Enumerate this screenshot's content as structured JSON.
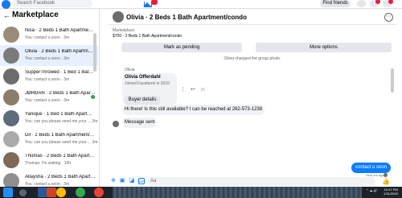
{
  "topbar": {
    "search_placeholder": "Search Facebook",
    "find_friends": "Find friends"
  },
  "sidebar": {
    "back_icon": "←",
    "title": "Marketplace",
    "items": [
      {
        "title": "Nisa · 2 Beds 1 Bath Apartment/...",
        "subtitle": "You: contact u soon · 3m",
        "active": false
      },
      {
        "title": "Olivia · 2 Beds 1 Bath Apartment/...",
        "subtitle": "You: contact u soon · 3m",
        "active": true
      },
      {
        "title": "SupperThrowed · 1 Bed 1 Bath Apart...",
        "subtitle": "You: contact u soon · 3m",
        "active": false
      },
      {
        "title": "JØRÐAN · 2 Beds 1 Bath Apartment/...",
        "subtitle": "You: contact u soon · 3m",
        "active": false
      },
      {
        "title": "Yanique · 1 Bed 1 Bath Apartment/...",
        "subtitle": "You: can you please send me your ... 3m",
        "active": false
      },
      {
        "title": "Dil · 2 Beds 1 Bath Apartment/condo",
        "subtitle": "You: can you please send me your ... 3m",
        "active": false
      },
      {
        "title": "Thomas · 2 Beds 1 Bath Apartment/...",
        "subtitle": "Thomas: I'm waiting · 10h",
        "active": false
      },
      {
        "title": "Allaysha · 2 Beds 1 Bath Apartment/...",
        "subtitle": "You: contact u soon · 3m",
        "active": false
      }
    ]
  },
  "chat": {
    "title": "Olivia · 2 Beds 1 Bath Apartment/condo",
    "listing_label": "Marketplace",
    "listing_price": "$700 · 2 Beds 1 Bath Apartment/condo",
    "mark_pending": "Mark as pending",
    "more_options": "More options",
    "system_message": "Olivia changed the group photo.",
    "sender_name": "Olivia",
    "card_name": "Olivia Offerdahl",
    "card_joined": "Joined Facebook in 2010",
    "card_button": "Buyer details",
    "message_1": "Hi there! Is this still available? I can be reached at 262-573-1238",
    "message_2": "Message sent",
    "my_message": "contact u soon",
    "seen_label": "Sent 4m ago",
    "composer_placeholder": "Aa"
  },
  "taskbar": {
    "clock_time": "10:47 PM",
    "clock_date": "1/31/2023"
  },
  "colors": {
    "accent": "#1877f2",
    "bubble_mine": "#0a7cff",
    "active_item": "#e7f0fd"
  }
}
